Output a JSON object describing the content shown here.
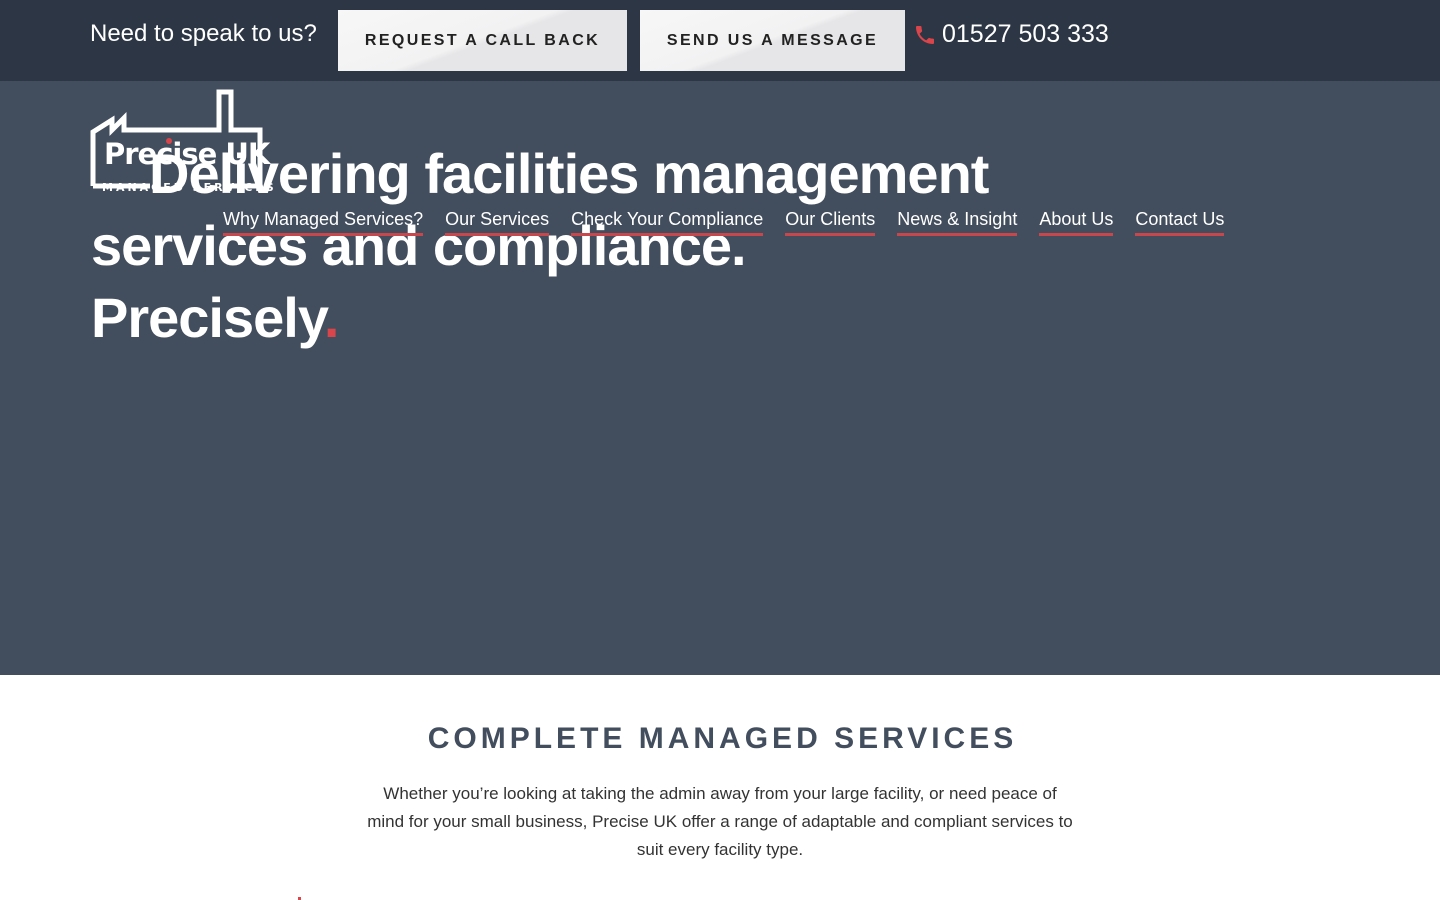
{
  "topbar": {
    "prompt": "Need to speak to us?",
    "request_callback_label": "REQUEST A CALL BACK",
    "send_message_label": "SEND US A MESSAGE",
    "phone_icon": "phone-icon",
    "phone_number": "01527 503 333"
  },
  "logo": {
    "name": "Precise UK",
    "subtitle": "MANAGED SERVICES"
  },
  "hero": {
    "headline_line1": "Delivering facilities management",
    "headline_line2": "services and compliance. ",
    "headline_emphasis": "Precisely",
    "headline_dot": "."
  },
  "nav": {
    "items": [
      {
        "label": "Why Managed Services?"
      },
      {
        "label": "Our Services"
      },
      {
        "label": "Check Your Compliance"
      },
      {
        "label": "Our Clients"
      },
      {
        "label": "News & Insight"
      },
      {
        "label": "About Us"
      },
      {
        "label": "Contact Us"
      }
    ]
  },
  "intro": {
    "title": "COMPLETE MANAGED SERVICES",
    "body": "Whether you’re looking at taking the admin away from your large facility, or need peace of mind for your small business, Precise UK offer a range of adaptable and compliant services to suit every facility type."
  },
  "colors": {
    "topbar_bg": "#2d3644",
    "hero_bg": "#424e5d",
    "accent_red": "#d9454a",
    "heading": "#424e5d"
  }
}
